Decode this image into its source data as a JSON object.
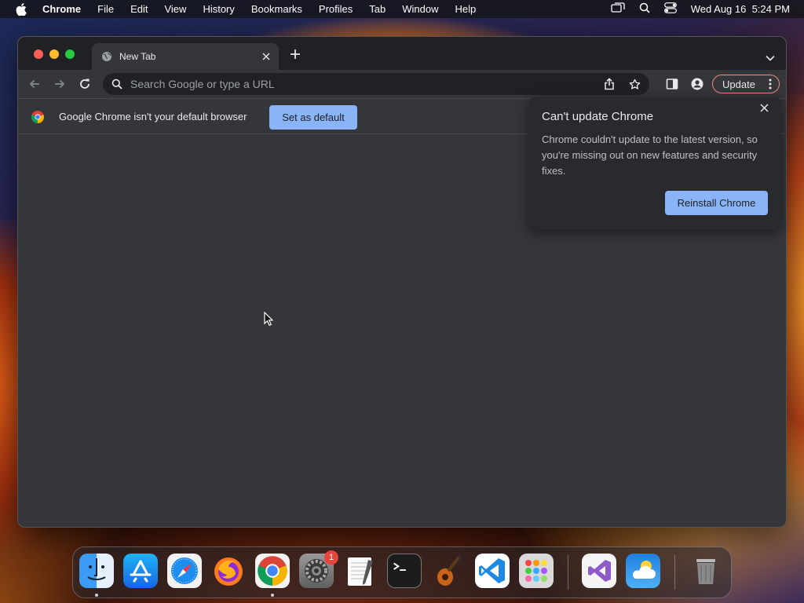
{
  "menubar": {
    "app_name": "Chrome",
    "items": [
      "File",
      "Edit",
      "View",
      "History",
      "Bookmarks",
      "Profiles",
      "Tab",
      "Window",
      "Help"
    ],
    "datetime": "Wed Aug 16  5:24 PM"
  },
  "browser": {
    "tab_title": "New Tab",
    "omnibox_placeholder": "Search Google or type a URL",
    "update_label": "Update"
  },
  "infobar": {
    "message": "Google Chrome isn't your default browser",
    "button_label": "Set as default"
  },
  "update_popup": {
    "title": "Can't update Chrome",
    "body": "Chrome couldn't update to the latest version, so you're missing out on new features and security fixes.",
    "button_label": "Reinstall Chrome"
  },
  "dock": {
    "apps": [
      "finder-icon",
      "app-store-icon",
      "safari-icon",
      "firefox-icon",
      "chrome-icon",
      "system-settings-icon",
      "textedit-icon",
      "terminal-icon",
      "garageband-icon",
      "vscode-icon",
      "launchpad-icon",
      "visual-studio-icon",
      "weather-icon",
      "trash-icon"
    ],
    "settings_badge": "1"
  },
  "colors": {
    "accent": "#8ab4f8",
    "update_border": "#f28b82",
    "window_bg": "#35363a",
    "tabstrip_bg": "#202124"
  }
}
